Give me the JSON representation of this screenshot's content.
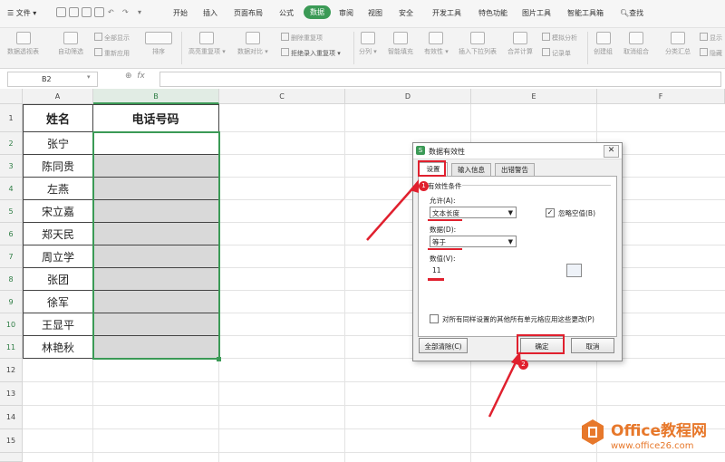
{
  "menubar": {
    "file_label": "文件",
    "tabs": [
      "开始",
      "插入",
      "页面布局",
      "公式",
      "数据",
      "审阅",
      "视图",
      "安全",
      "开发工具",
      "特色功能",
      "图片工具",
      "智能工具箱"
    ],
    "active_tab": "数据",
    "search_label": "查找"
  },
  "ribbon": {
    "pivot": "数据透视表",
    "autofilter": "自动筛选",
    "show_all": "全部显示",
    "reapply": "重新应用",
    "sort": "排序",
    "highlight_dup": "高亮重复项",
    "data_compare": "数据对比",
    "remove_dup": "删除重复项",
    "reject_dup": "拒绝录入重复项",
    "split": "分列",
    "smart_fill": "智能填充",
    "validity": "有效性",
    "dropdown_list": "插入下拉列表",
    "consolidate": "合并计算",
    "simulate": "模拟分析",
    "record_form": "记录单",
    "group": "创建组",
    "ungroup": "取消组合",
    "subtotal": "分类汇总",
    "show_detail": "显示",
    "hide_detail": "隐藏"
  },
  "formula_bar": {
    "name_box": "B2",
    "fx": "fx"
  },
  "grid": {
    "columns": [
      "A",
      "B",
      "C",
      "D",
      "E",
      "F"
    ],
    "rows": [
      "1",
      "2",
      "3",
      "4",
      "5",
      "6",
      "7",
      "8",
      "9",
      "10",
      "11",
      "12",
      "13",
      "14",
      "15"
    ],
    "header_name": "姓名",
    "header_phone": "电话号码",
    "names": [
      "张宁",
      "陈同贵",
      "左燕",
      "宋立嘉",
      "郑天民",
      "周立学",
      "张团",
      "徐军",
      "王显平",
      "林艳秋"
    ]
  },
  "dialog": {
    "title": "数据有效性",
    "close": "✕",
    "tabs": [
      "设置",
      "输入信息",
      "出错警告"
    ],
    "section_title": "有效性条件",
    "allow_label": "允许(A):",
    "allow_value": "文本长度",
    "ignore_blank_label": "忽略空值(B)",
    "ignore_blank_checked": "✓",
    "data_label": "数据(D):",
    "data_value": "等于",
    "value_label": "数值(V):",
    "value_value": "11",
    "apply_all_label": "对所有同样设置的其他所有单元格应用这些更改(P)",
    "clear_all": "全部清除(C)",
    "ok": "确定",
    "cancel": "取消"
  },
  "annotations": {
    "badge1": "1",
    "badge2": "2",
    "accent": "#e0202e"
  },
  "watermark": {
    "title": "Office教程网",
    "url": "www.office26.com"
  },
  "colors": {
    "green": "#3b9a56",
    "cell_fill": "#d9d9d9",
    "watermark": "#e7782b"
  }
}
